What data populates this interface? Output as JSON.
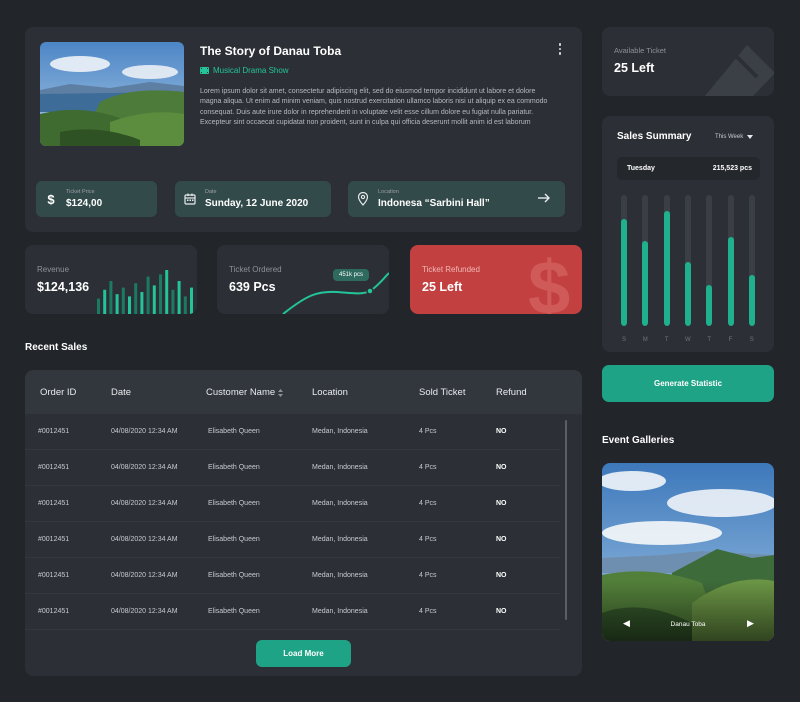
{
  "event": {
    "title": "The Story of Danau Toba",
    "genre": "Musical Drama Show",
    "description": "Lorem ipsum dolor sit amet, consectetur adipiscing elit, sed do eiusmod tempor incididunt ut labore et dolore magna aliqua. Ut enim ad minim veniam, quis nostrud exercitation ullamco laboris nisi ut aliquip ex ea commodo consequat. Duis aute irure dolor in reprehenderit in voluptate velit esse cillum dolore eu fugiat nulla pariatur. Excepteur sint occaecat cupidatat non proident, sunt in culpa qui officia deserunt mollit anim id est laborum",
    "price_label": "Ticket Price",
    "price_value": "$124,00",
    "date_label": "Date",
    "date_value": "Sunday, 12 June 2020",
    "location_label": "Location",
    "location_value": "Indonesa “Sarbini Hall”"
  },
  "stats": {
    "revenue": {
      "label": "Revenue",
      "value": "$124,136"
    },
    "ordered": {
      "label": "Ticket Ordered",
      "value": "639 Pcs",
      "tooltip": "451k pcs"
    },
    "refunded": {
      "label": "Ticket Refunded",
      "value": "25 Left"
    }
  },
  "revenue_bars": [
    0.35,
    0.55,
    0.75,
    0.45,
    0.6,
    0.4,
    0.7,
    0.5,
    0.85,
    0.65,
    0.9,
    1.0,
    0.55,
    0.75,
    0.4,
    0.6
  ],
  "available": {
    "label": "Available Ticket",
    "value": "25 Left"
  },
  "summary": {
    "title": "Sales Summary",
    "range": "This Week",
    "tooltip_day": "Tuesday",
    "tooltip_amount": "215,523 pcs",
    "days": [
      "S",
      "M",
      "T",
      "W",
      "T",
      "F",
      "S"
    ],
    "levels": [
      0.82,
      0.65,
      0.88,
      0.49,
      0.31,
      0.68,
      0.39
    ]
  },
  "generate_label": "Generate Statistic",
  "recent_sales": {
    "title": "Recent Sales",
    "columns": [
      "Order ID",
      "Date",
      "Customer Name",
      "Location",
      "Sold Ticket",
      "Refund"
    ],
    "rows": [
      [
        "#0012451",
        "04/08/2020 12:34 AM",
        "Elisabeth Queen",
        "Medan, Indonesia",
        "4 Pcs",
        "NO"
      ],
      [
        "#0012451",
        "04/08/2020 12:34 AM",
        "Elisabeth Queen",
        "Medan, Indonesia",
        "4 Pcs",
        "NO"
      ],
      [
        "#0012451",
        "04/08/2020 12:34 AM",
        "Elisabeth Queen",
        "Medan, Indonesia",
        "4 Pcs",
        "NO"
      ],
      [
        "#0012451",
        "04/08/2020 12:34 AM",
        "Elisabeth Queen",
        "Medan, Indonesia",
        "4 Pcs",
        "NO"
      ],
      [
        "#0012451",
        "04/08/2020 12:34 AM",
        "Elisabeth Queen",
        "Medan, Indonesia",
        "4 Pcs",
        "NO"
      ],
      [
        "#0012451",
        "04/08/2020 12:34 AM",
        "Elisabeth Queen",
        "Medan, Indonesia",
        "4 Pcs",
        "NO"
      ]
    ],
    "load_more": "Load More"
  },
  "galleries": {
    "title": "Event Galleries",
    "caption": "Danau Toba"
  },
  "icons": {
    "genre": "film-icon",
    "price": "dollar-icon",
    "date": "calendar-icon",
    "location": "map-pin-icon",
    "arrow": "arrow-right-icon",
    "menu": "more-vertical-icon",
    "sort": "sort-icon",
    "dropdown": "chevron-down-icon"
  },
  "colors": {
    "background": "#22252a",
    "card": "#2c3036",
    "accent": "#23c49a",
    "button": "#1fa386",
    "danger": "#c24040"
  }
}
